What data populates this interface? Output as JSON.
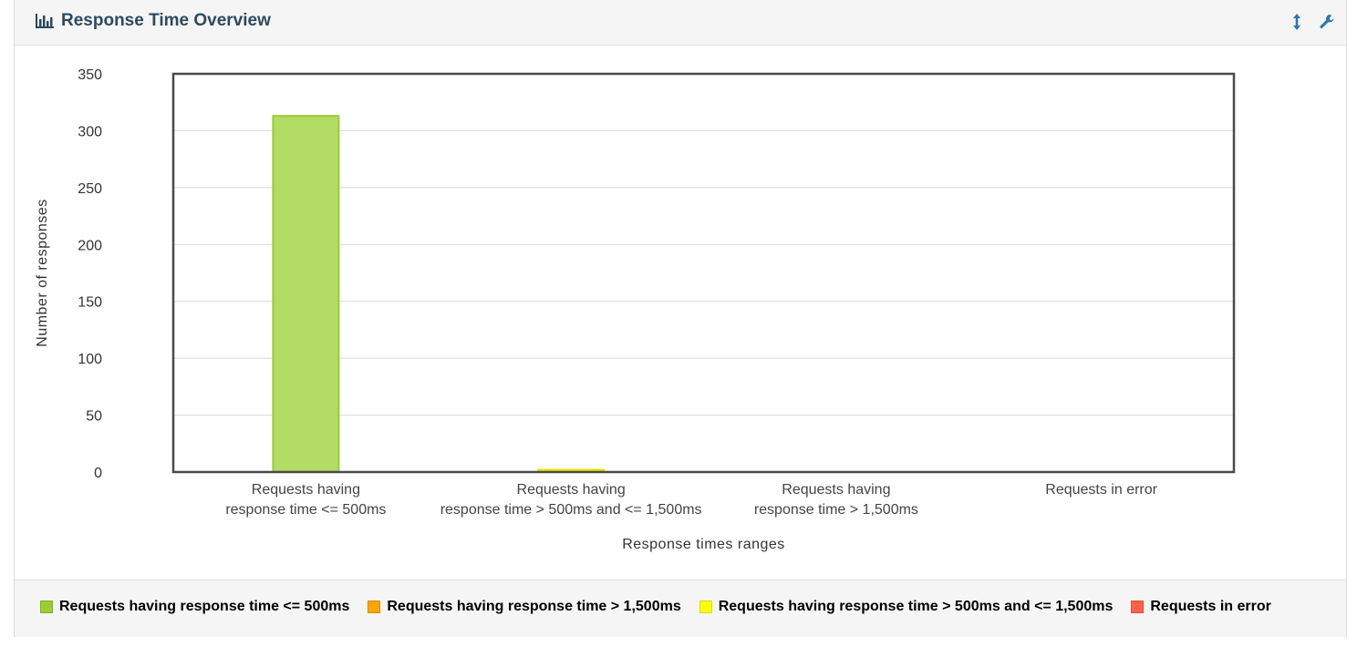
{
  "panel": {
    "title": "Response Time Overview",
    "title_icon": "bar-chart-icon",
    "tools": [
      "resize-vertical-icon",
      "wrench-icon"
    ]
  },
  "chart_data": {
    "type": "bar",
    "title": "",
    "xlabel": "Response times ranges",
    "ylabel": "Number of responses",
    "ylim": [
      0,
      350
    ],
    "yticks": [
      "350",
      "300",
      "250",
      "200",
      "150",
      "100",
      "50",
      "0"
    ],
    "categories": [
      [
        "Requests having",
        "response time <= 500ms"
      ],
      [
        "Requests having",
        "response time > 500ms and <= 1,500ms"
      ],
      [
        "Requests having",
        "response time > 1,500ms"
      ],
      [
        "Requests in error"
      ]
    ],
    "values": [
      313,
      2,
      0,
      0
    ],
    "colors": [
      "#b2dc63",
      "#ffff00",
      "#ffa500",
      "#ff6347"
    ],
    "border_colors": [
      "#9acd32",
      "#e6e600",
      "#e69500",
      "#e5533a"
    ],
    "grid": true,
    "legend_position": "bottom",
    "legend": [
      {
        "label": "Requests having response time <= 500ms",
        "color": "#9acd32"
      },
      {
        "label": "Requests having response time > 1,500ms",
        "color": "#ffa500"
      },
      {
        "label": "Requests having response time > 500ms and <= 1,500ms",
        "color": "#ffff00"
      },
      {
        "label": "Requests in error",
        "color": "#ff6347"
      }
    ]
  }
}
